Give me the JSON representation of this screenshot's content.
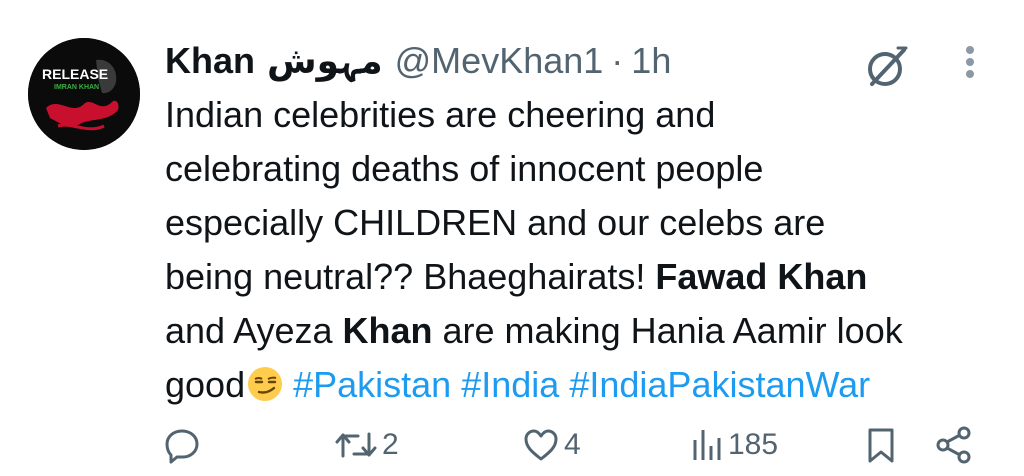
{
  "author": {
    "display_name": "Khan",
    "urdu_name": "مہوش",
    "handle": "@MevKhan1",
    "separator": "·",
    "time": "1h"
  },
  "avatar": {
    "top_text": "RELEASE",
    "sub_text": "IMRAN KHAN"
  },
  "tweet": {
    "l1": "Indian celebrities are cheering and",
    "l2": "celebrating deaths of innocent people",
    "l3": "especially CHILDREN and our celebs are",
    "l4a": "being neutral?? Bhaeghairats! ",
    "l4b": "Fawad Khan",
    "l5a": "and Ayeza ",
    "l5b": "Khan",
    "l5c": " are making Hania Aamir look",
    "l6a": "good",
    "hashtags": [
      "#Pakistan",
      "#India",
      "#IndiaPakistanWar"
    ]
  },
  "actions": {
    "replies": "",
    "reposts": "2",
    "likes": "4",
    "views": "185"
  },
  "icons": [
    "grok-icon",
    "more-icon",
    "reply-icon",
    "repost-icon",
    "like-icon",
    "views-icon",
    "bookmark-icon",
    "share-icon",
    "smirk-emoji"
  ],
  "colors": {
    "text": "#0f1419",
    "secondary": "#536471",
    "hashtag": "#1d9bf0"
  }
}
